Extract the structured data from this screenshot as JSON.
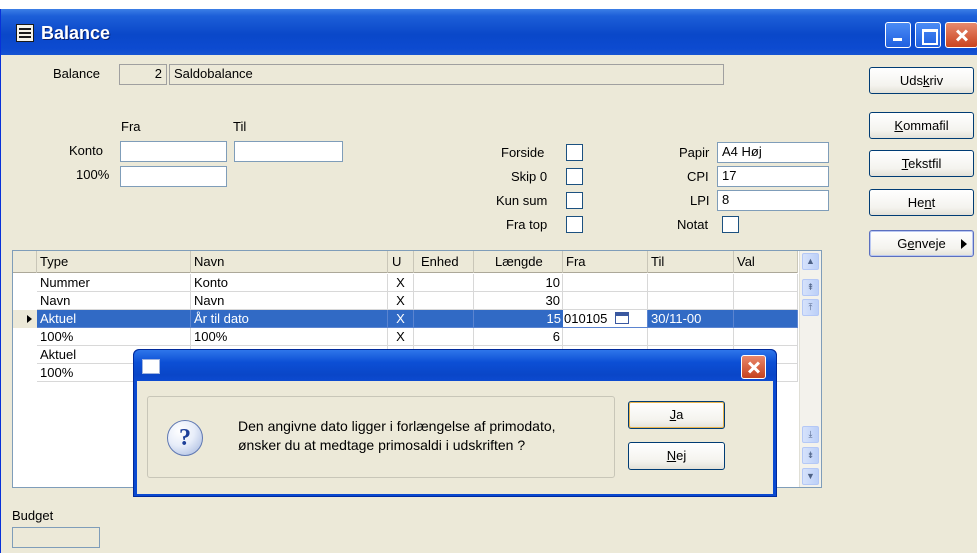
{
  "window": {
    "title": "Balance"
  },
  "header": {
    "balance_label": "Balance",
    "balance_number": "2",
    "balance_name": "Saldobalance",
    "fra_label": "Fra",
    "til_label": "Til",
    "konto_label": "Konto",
    "pct_label": "100%",
    "konto_fra_value": "",
    "konto_til_value": "",
    "pct_value": ""
  },
  "options": {
    "forside": "Forside",
    "skip0": "Skip 0",
    "kunsum": "Kun sum",
    "fratop": "Fra top",
    "papir_label": "Papir",
    "papir_value": "A4 Høj",
    "cpi_label": "CPI",
    "cpi_value": "17",
    "lpi_label": "LPI",
    "lpi_value": "8",
    "notat_label": "Notat"
  },
  "buttons": {
    "udskriv_pre": "Uds",
    "udskriv_acc": "k",
    "udskriv_post": "riv",
    "kommafil_acc": "K",
    "kommafil_post": "ommafil",
    "tekstfil_acc": "T",
    "tekstfil_post": "ekstfil",
    "hent_pre": "He",
    "hent_acc": "n",
    "hent_post": "t",
    "genveje_pre": "G",
    "genveje_acc": "e",
    "genveje_post": "nveje"
  },
  "grid": {
    "columns": [
      "Type",
      "Navn",
      "U",
      "Enhed",
      "Længde",
      "Fra",
      "Til",
      "Val"
    ],
    "rows": [
      {
        "type": "Nummer",
        "navn": "Konto",
        "u": "X",
        "enhed": "",
        "laengde": "10",
        "fra": "",
        "til": "",
        "val": ""
      },
      {
        "type": "Navn",
        "navn": "Navn",
        "u": "X",
        "enhed": "",
        "laengde": "30",
        "fra": "",
        "til": "",
        "val": ""
      },
      {
        "type": "Aktuel",
        "navn": "År til dato",
        "u": "X",
        "enhed": "",
        "laengde": "15",
        "fra": "010105",
        "til": "30/11-00",
        "val": ""
      },
      {
        "type": "100%",
        "navn": "100%",
        "u": "X",
        "enhed": "",
        "laengde": "6",
        "fra": "",
        "til": "",
        "val": ""
      },
      {
        "type": "Aktuel",
        "navn": "",
        "u": "",
        "enhed": "",
        "laengde": "",
        "fra": "",
        "til": "",
        "val": ""
      },
      {
        "type": "100%",
        "navn": "",
        "u": "",
        "enhed": "",
        "laengde": "",
        "fra": "",
        "til": "",
        "val": ""
      }
    ]
  },
  "budget": {
    "label": "Budget"
  },
  "dialog": {
    "message_line1": "Den angivne dato ligger i forlængelse af primodato,",
    "message_line2": "ønsker du at medtage primosaldi i udskriften ?",
    "ja_acc": "J",
    "ja_post": "a",
    "nej_acc": "N",
    "nej_post": "ej"
  },
  "icons": [
    "window-icon",
    "question-icon",
    "calendar-icon",
    "close-icon",
    "minimize-icon",
    "maximize-icon"
  ]
}
